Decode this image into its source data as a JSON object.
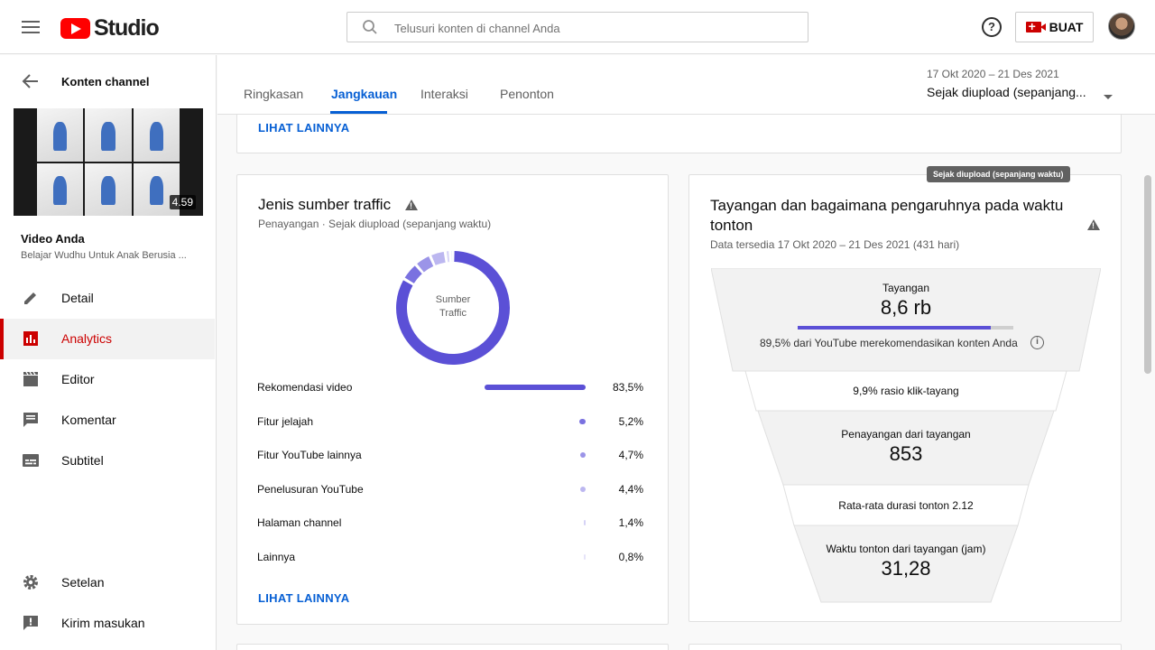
{
  "header": {
    "logo_text": "Studio",
    "search_placeholder": "Telusuri konten di channel Anda",
    "help_glyph": "?",
    "create_label": "BUAT"
  },
  "sidebar": {
    "back_label": "Konten channel",
    "thumbnail_duration": "4.59",
    "video_label": "Video Anda",
    "video_title": "Belajar Wudhu Untuk Anak Berusia ...",
    "items": [
      {
        "label": "Detail",
        "icon": "pencil-icon"
      },
      {
        "label": "Analytics",
        "icon": "analytics-icon",
        "active": true
      },
      {
        "label": "Editor",
        "icon": "clapperboard-icon"
      },
      {
        "label": "Komentar",
        "icon": "comment-icon"
      },
      {
        "label": "Subtitel",
        "icon": "subtitles-icon"
      }
    ],
    "bottom_items": [
      {
        "label": "Setelan",
        "icon": "gear-icon"
      },
      {
        "label": "Kirim masukan",
        "icon": "feedback-icon"
      }
    ]
  },
  "tabs": [
    {
      "label": "Ringkasan"
    },
    {
      "label": "Jangkauan",
      "active": true
    },
    {
      "label": "Interaksi"
    },
    {
      "label": "Penonton"
    }
  ],
  "date_range": {
    "dates": "17 Okt 2020 – 21 Des 2021",
    "label": "Sejak diupload (sepanjang..."
  },
  "top_card": {
    "link": "LIHAT LAINNYA"
  },
  "traffic_card": {
    "title": "Jenis sumber traffic",
    "subtitle": "Penayangan · Sejak diupload (sepanjang waktu)",
    "donut_label_1": "Sumber",
    "donut_label_2": "Traffic",
    "link": "LIHAT LAINNYA",
    "sources": [
      {
        "name": "Rekomendasi video",
        "pct": "83,5%",
        "value": 83.5,
        "color": "#5b50d6"
      },
      {
        "name": "Fitur jelajah",
        "pct": "5,2%",
        "value": 5.2,
        "color": "#7a71e0"
      },
      {
        "name": "Fitur YouTube lainnya",
        "pct": "4,7%",
        "value": 4.7,
        "color": "#9b94e8"
      },
      {
        "name": "Penelusuran YouTube",
        "pct": "4,4%",
        "value": 4.4,
        "color": "#bcb7f0"
      },
      {
        "name": "Halaman channel",
        "pct": "1,4%",
        "value": 1.4,
        "color": "#d6d3f6"
      },
      {
        "name": "Lainnya",
        "pct": "0,8%",
        "value": 0.8,
        "color": "#e6e4f9"
      }
    ]
  },
  "funnel_card": {
    "tooltip": "Sejak diupload (sepanjang waktu)",
    "title_line1": "Tayangan dan bagaimana pengaruhnya pada waktu",
    "title_line2": "tonton",
    "subtitle": "Data tersedia 17 Okt 2020 – 21 Des 2021 (431 hari)",
    "impressions_label": "Tayangan",
    "impressions_value": "8,6 rb",
    "impressions_progress": 0.895,
    "recommend_text": "89,5% dari YouTube merekomendasikan konten Anda",
    "ctr_text": "9,9% rasio klik-tayang",
    "views_label": "Penayangan dari tayangan",
    "views_value": "853",
    "avg_duration_text": "Rata-rata durasi tonton 2.12",
    "watch_time_label": "Waktu tonton dari tayangan (jam)",
    "watch_time_value": "31,28"
  }
}
